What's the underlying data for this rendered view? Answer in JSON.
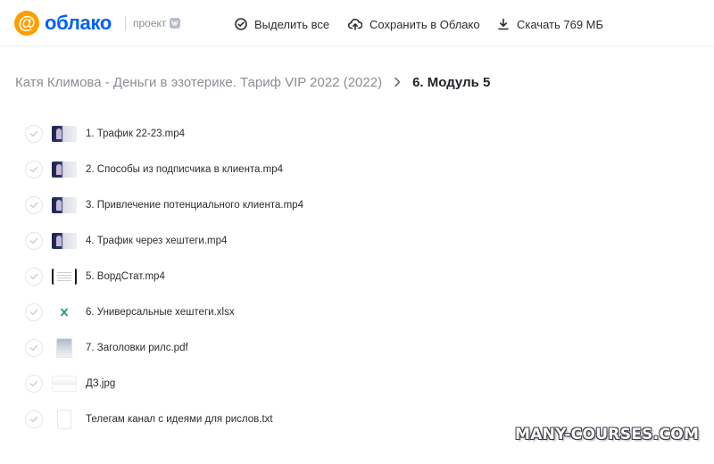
{
  "header": {
    "logo_symbol": "@",
    "logo_text": "облако",
    "project_label": "проект",
    "project_badge": "vk",
    "actions": {
      "select_all": "Выделить все",
      "save_to_cloud": "Сохранить в Облако",
      "download": "Скачать 769 МБ"
    }
  },
  "breadcrumb": {
    "parent": "Катя Климова - Деньги в эзотерике. Тариф VIP 2022 (2022)",
    "current": "6. Модуль 5"
  },
  "files": [
    {
      "name": "1. Трафик 22-23.mp4",
      "thumb": "video"
    },
    {
      "name": "2. Способы из подписчика в клиента.mp4",
      "thumb": "video"
    },
    {
      "name": "3. Привлечение потенциального клиента.mp4",
      "thumb": "video"
    },
    {
      "name": "4. Трафик через хештеги.mp4",
      "thumb": "video"
    },
    {
      "name": "5. ВордСтат.mp4",
      "thumb": "word"
    },
    {
      "name": "6. Универсальные хештеги.xlsx",
      "thumb": "xlsx"
    },
    {
      "name": "7. Заголовки рилс.pdf",
      "thumb": "pdf"
    },
    {
      "name": "ДЗ.jpg",
      "thumb": "jpg"
    },
    {
      "name": "Телегам канал с идеями для рислов.txt",
      "thumb": "txt"
    }
  ],
  "watermark": {
    "text": "MANY-COURSES.COM"
  },
  "colors": {
    "brand_orange": "#ff9e00",
    "brand_blue": "#005ff9",
    "xlsx_green": "#21a366"
  },
  "icons": {
    "select_all": "check-circle-icon",
    "save_to_cloud": "cloud-upload-icon",
    "download": "download-icon",
    "breadcrumb_separator": "chevron-right-icon",
    "row_checkbox": "check-icon"
  }
}
